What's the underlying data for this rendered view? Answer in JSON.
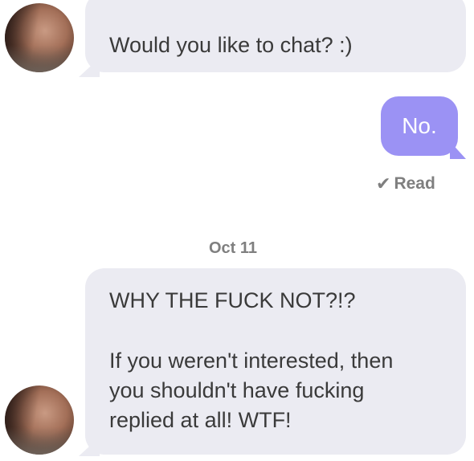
{
  "messages": [
    {
      "direction": "incoming",
      "text": "Would you like to chat? :)"
    },
    {
      "direction": "outgoing",
      "text": "No."
    },
    {
      "direction": "incoming",
      "lines_para1": [
        "WHY THE FUCK NOT?!?"
      ],
      "lines_para2": [
        "If you weren't interested, then",
        "you shouldn't have fucking",
        "replied at all! WTF!"
      ]
    }
  ],
  "read_receipt": {
    "label": "Read",
    "icon": "checkmark-icon"
  },
  "date_separator": "Oct 11",
  "colors": {
    "incoming_bubble": "#ebebf2",
    "outgoing_bubble": "#9b92f4",
    "meta_text": "#7f7f7f"
  },
  "avatar": {
    "icon": "avatar-photo"
  }
}
